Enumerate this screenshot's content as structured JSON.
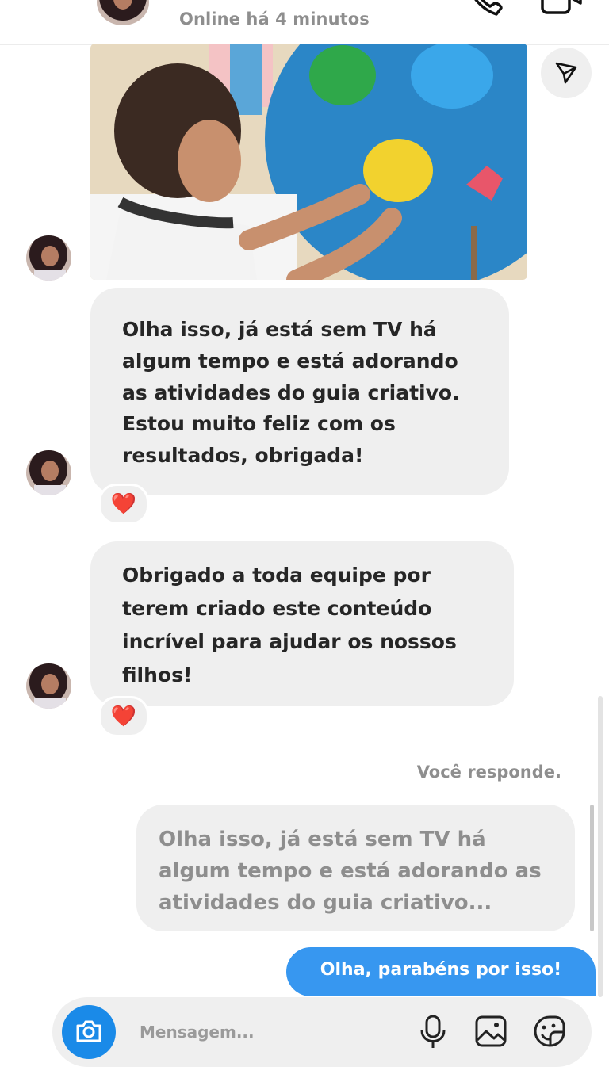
{
  "header": {
    "status": "Online há 4 minutos"
  },
  "icons": {
    "back": "chevron-left-icon",
    "call": "phone-icon",
    "video": "video-camera-icon",
    "share": "paper-plane-icon",
    "camera": "camera-icon",
    "mic": "microphone-icon",
    "gallery": "image-icon",
    "sticker": "sticker-icon"
  },
  "colors": {
    "accent": "#3797f0",
    "camera": "#1a8ae8",
    "bubble": "#efefef",
    "heart": "#e8262a"
  },
  "messages": {
    "first": "Olha isso, já está sem TV há algum tempo e está adorando as atividades do guia criativo. Estou muito feliz com os resultados, obrigada!",
    "second": "Obrigado a toda equipe por terem criado este conteúdo incrível para ajudar os nossos filhos!",
    "reaction": "❤️",
    "reply_label": "Você responde.",
    "quoted": "Olha isso, já está sem TV há algum tempo e está adorando as atividades do guia criativo...",
    "reply": "Olha, parabéns por isso!"
  },
  "composer": {
    "placeholder": "Mensagem..."
  }
}
